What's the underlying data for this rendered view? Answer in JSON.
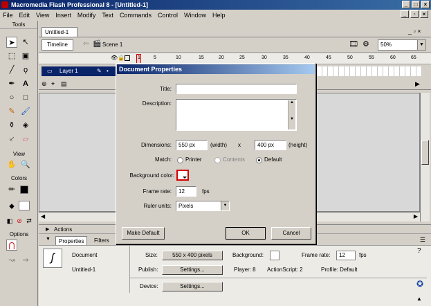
{
  "window": {
    "title": "Macromedia Flash Professional 8 - [Untitled-1]"
  },
  "menu": [
    "File",
    "Edit",
    "View",
    "Insert",
    "Modify",
    "Text",
    "Commands",
    "Control",
    "Window",
    "Help"
  ],
  "tools": {
    "header": "Tools",
    "view_label": "View",
    "colors_label": "Colors",
    "options_label": "Options"
  },
  "document": {
    "tab": "Untitled-1",
    "timeline_button": "Timeline",
    "scene": "Scene 1",
    "zoom": "50%",
    "frame_numbers": [
      "1",
      "5",
      "10",
      "15",
      "20",
      "25",
      "30",
      "35",
      "40",
      "45",
      "50",
      "55",
      "60",
      "65"
    ],
    "layer_name": "Layer 1"
  },
  "dialog": {
    "title": "Document Properties",
    "title_label": "Title:",
    "title_value": "",
    "description_label": "Description:",
    "description_value": "",
    "dimensions_label": "Dimensions:",
    "width_value": "550 px",
    "width_unit": "(width)",
    "times": "x",
    "height_value": "400 px",
    "height_unit": "(height)",
    "match_label": "Match:",
    "match_options": [
      "Printer",
      "Contents",
      "Default"
    ],
    "match_selected": "Default",
    "bg_color_label": "Background color:",
    "frame_rate_label": "Frame rate:",
    "frame_rate_value": "12",
    "fps": "fps",
    "ruler_label": "Ruler units:",
    "ruler_value": "Pixels",
    "make_default": "Make Default",
    "ok": "OK",
    "cancel": "Cancel"
  },
  "panels": {
    "actions": "Actions",
    "tabs": [
      "Properties",
      "Filters"
    ]
  },
  "properties": {
    "doc_type": "Document",
    "doc_name": "Untitled-1",
    "size_label": "Size:",
    "size_value": "550 x 400 pixels",
    "background_label": "Background:",
    "frame_rate_label": "Frame rate:",
    "frame_rate_value": "12",
    "fps": "fps",
    "publish_label": "Publish:",
    "settings_button": "Settings...",
    "player": "Player: 8",
    "actionscript": "ActionScript:  2",
    "profile": "Profile:  Default",
    "device_label": "Device:",
    "device_settings_button": "Settings..."
  }
}
